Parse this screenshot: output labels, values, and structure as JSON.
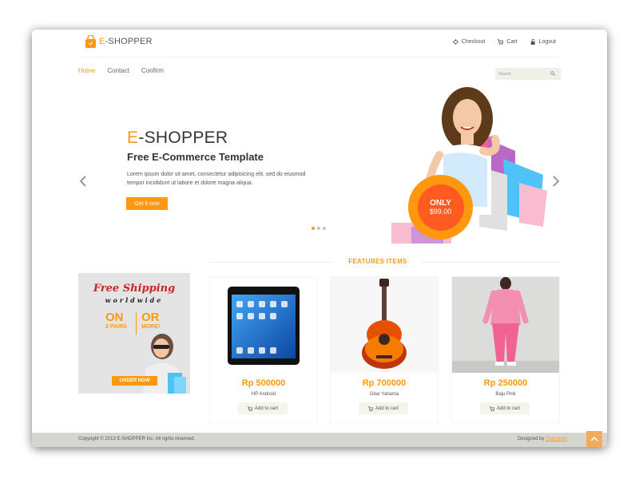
{
  "brand": {
    "name_e": "E",
    "name_rest": "-SHOPPER",
    "accent": "#FE980F"
  },
  "top_links": [
    {
      "label": "Checkout",
      "icon": "crosshair-icon"
    },
    {
      "label": "Cart",
      "icon": "shopping-cart-icon"
    },
    {
      "label": "Logout",
      "icon": "lock-icon"
    }
  ],
  "nav": [
    {
      "label": "Home",
      "active": true
    },
    {
      "label": "Contact",
      "active": false
    },
    {
      "label": "Confirm",
      "active": false
    }
  ],
  "search": {
    "placeholder": "Search"
  },
  "hero": {
    "title_e": "E",
    "title_rest": "-SHOPPER",
    "subtitle": "Free E-Commerce Template",
    "description": "Lorem ipsum dolor sit amet, consectetur adipisicing elit, sed do eiusmod tempor incididunt ut labore et dolore magna aliqua.",
    "button": "Get it now",
    "badge_only": "ONLY",
    "badge_price": "$99.00"
  },
  "features_title": "FEATURES ITEMS",
  "ad": {
    "line1": "Free Shipping",
    "line2": "worldwide",
    "on": "ON",
    "or": "OR",
    "pairs": "2 PAIRS",
    "more": "MORE!",
    "order": "ORDER NOW"
  },
  "products": [
    {
      "price": "Rp 500000",
      "name": "HP Android",
      "cart": "Add to cart"
    },
    {
      "price": "Rp 700000",
      "name": "Gitar Yahama",
      "cart": "Add to cart"
    },
    {
      "price": "Rp 250000",
      "name": "Baju Pink",
      "cart": "Add to cart"
    }
  ],
  "footer": {
    "copyright": "Copyright © 2013 E-SHOPPER Inc. All rights reserved.",
    "designed_by": "Designed by",
    "designer": "Themeum"
  }
}
